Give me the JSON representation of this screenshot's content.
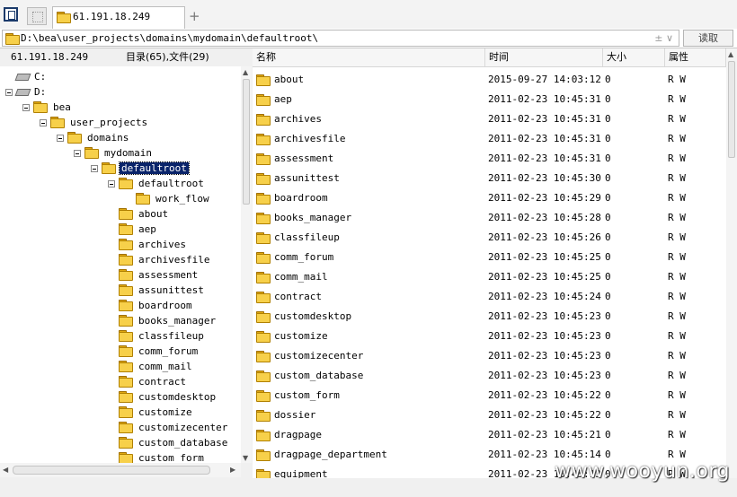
{
  "tab": {
    "title": "61.191.18.249"
  },
  "address": {
    "path": "D:\\bea\\user_projects\\domains\\mydomain\\defaultroot\\",
    "controls": "± ∨",
    "read_button": "读取"
  },
  "left_header": {
    "host": "61.191.18.249",
    "count": "目录(65),文件(29)"
  },
  "tree": [
    {
      "label": "C:",
      "type": "drive",
      "level": 1,
      "exp": false
    },
    {
      "label": "D:",
      "type": "drive",
      "level": 1,
      "exp": true
    },
    {
      "label": "bea",
      "type": "folder",
      "level": 2,
      "exp": true
    },
    {
      "label": "user_projects",
      "type": "folder",
      "level": 3,
      "exp": true
    },
    {
      "label": "domains",
      "type": "folder",
      "level": 4,
      "exp": true
    },
    {
      "label": "mydomain",
      "type": "folder",
      "level": 5,
      "exp": true
    },
    {
      "label": "defaultroot",
      "type": "folder-open",
      "level": 6,
      "exp": true,
      "selected": true
    },
    {
      "label": "defaultroot",
      "type": "folder",
      "level": 7,
      "exp": true
    },
    {
      "label": "work_flow",
      "type": "folder",
      "level": 8,
      "exp": false
    },
    {
      "label": "about",
      "type": "folder",
      "level": 7,
      "exp": false
    },
    {
      "label": "aep",
      "type": "folder",
      "level": 7,
      "exp": false
    },
    {
      "label": "archives",
      "type": "folder",
      "level": 7,
      "exp": false
    },
    {
      "label": "archivesfile",
      "type": "folder",
      "level": 7,
      "exp": false
    },
    {
      "label": "assessment",
      "type": "folder",
      "level": 7,
      "exp": false
    },
    {
      "label": "assunittest",
      "type": "folder",
      "level": 7,
      "exp": false
    },
    {
      "label": "boardroom",
      "type": "folder",
      "level": 7,
      "exp": false
    },
    {
      "label": "books_manager",
      "type": "folder",
      "level": 7,
      "exp": false
    },
    {
      "label": "classfileup",
      "type": "folder",
      "level": 7,
      "exp": false
    },
    {
      "label": "comm_forum",
      "type": "folder",
      "level": 7,
      "exp": false
    },
    {
      "label": "comm_mail",
      "type": "folder",
      "level": 7,
      "exp": false
    },
    {
      "label": "contract",
      "type": "folder",
      "level": 7,
      "exp": false
    },
    {
      "label": "customdesktop",
      "type": "folder",
      "level": 7,
      "exp": false
    },
    {
      "label": "customize",
      "type": "folder",
      "level": 7,
      "exp": false
    },
    {
      "label": "customizecenter",
      "type": "folder",
      "level": 7,
      "exp": false
    },
    {
      "label": "custom_database",
      "type": "folder",
      "level": 7,
      "exp": false
    },
    {
      "label": "custom_form",
      "type": "folder",
      "level": 7,
      "exp": false
    }
  ],
  "columns": {
    "name": "名称",
    "time": "时间",
    "size": "大小",
    "attr": "属性"
  },
  "files": [
    {
      "name": "about",
      "time": "2015-09-27 14:03:12",
      "size": "0",
      "attr": "R W"
    },
    {
      "name": "aep",
      "time": "2011-02-23 10:45:31",
      "size": "0",
      "attr": "R W"
    },
    {
      "name": "archives",
      "time": "2011-02-23 10:45:31",
      "size": "0",
      "attr": "R W"
    },
    {
      "name": "archivesfile",
      "time": "2011-02-23 10:45:31",
      "size": "0",
      "attr": "R W"
    },
    {
      "name": "assessment",
      "time": "2011-02-23 10:45:31",
      "size": "0",
      "attr": "R W"
    },
    {
      "name": "assunittest",
      "time": "2011-02-23 10:45:30",
      "size": "0",
      "attr": "R W"
    },
    {
      "name": "boardroom",
      "time": "2011-02-23 10:45:29",
      "size": "0",
      "attr": "R W"
    },
    {
      "name": "books_manager",
      "time": "2011-02-23 10:45:28",
      "size": "0",
      "attr": "R W"
    },
    {
      "name": "classfileup",
      "time": "2011-02-23 10:45:26",
      "size": "0",
      "attr": "R W"
    },
    {
      "name": "comm_forum",
      "time": "2011-02-23 10:45:25",
      "size": "0",
      "attr": "R W"
    },
    {
      "name": "comm_mail",
      "time": "2011-02-23 10:45:25",
      "size": "0",
      "attr": "R W"
    },
    {
      "name": "contract",
      "time": "2011-02-23 10:45:24",
      "size": "0",
      "attr": "R W"
    },
    {
      "name": "customdesktop",
      "time": "2011-02-23 10:45:23",
      "size": "0",
      "attr": "R W"
    },
    {
      "name": "customize",
      "time": "2011-02-23 10:45:23",
      "size": "0",
      "attr": "R W"
    },
    {
      "name": "customizecenter",
      "time": "2011-02-23 10:45:23",
      "size": "0",
      "attr": "R W"
    },
    {
      "name": "custom_database",
      "time": "2011-02-23 10:45:23",
      "size": "0",
      "attr": "R W"
    },
    {
      "name": "custom_form",
      "time": "2011-02-23 10:45:22",
      "size": "0",
      "attr": "R W"
    },
    {
      "name": "dossier",
      "time": "2011-02-23 10:45:22",
      "size": "0",
      "attr": "R W"
    },
    {
      "name": "dragpage",
      "time": "2011-02-23 10:45:21",
      "size": "0",
      "attr": "R W"
    },
    {
      "name": "dragpage_department",
      "time": "2011-02-23 10:45:14",
      "size": "0",
      "attr": "R W"
    },
    {
      "name": "equipment",
      "time": "2011-02-23 10:45:13",
      "size": "0",
      "attr": "R W"
    }
  ],
  "watermark": "www.wooyun.org"
}
